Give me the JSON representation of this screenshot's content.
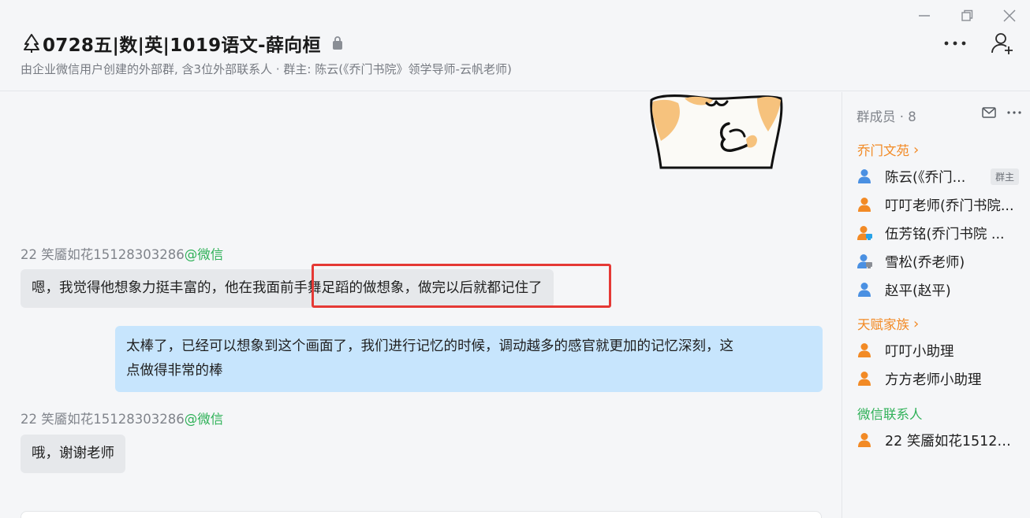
{
  "window": {
    "controls": [
      "minimize",
      "restore",
      "close"
    ]
  },
  "header": {
    "title": "0728五|数|英|1019语文-薛向桓",
    "subtitle": "由企业微信用户创建的外部群, 含3位外部联系人 · 群主: 陈云(《乔门书院》领学导师-云帆老师)"
  },
  "messages": [
    {
      "type": "sticker",
      "direction": "out"
    },
    {
      "type": "text",
      "direction": "in",
      "sender": "22 笑靥如花15128303286",
      "source": "@微信",
      "text": "嗯，我觉得他想象力挺丰富的，他在我面前手舞足蹈的做想象，做完以后就都记住了"
    },
    {
      "type": "text",
      "direction": "out",
      "lines": [
        "太棒了，已经可以想象到这个画面了，我们进行记忆的时候，调动越多的感官就更加的记忆深刻，这",
        "点做得非常的棒"
      ]
    },
    {
      "type": "text",
      "direction": "in",
      "sender": "22 笑靥如花15128303286",
      "source": "@微信",
      "text": "哦，谢谢老师"
    }
  ],
  "sidebar": {
    "title": "群成员 · 8",
    "sections": [
      {
        "label": "乔门文苑",
        "chevron": "›",
        "color": "#f28a25",
        "members": [
          {
            "name": "陈云(《乔门书院》领学导师-云帆老师)",
            "display": "陈云(《乔门...",
            "badge": "群主",
            "avatar": "person-blue"
          },
          {
            "name": "叮叮老师(乔门书院...",
            "avatar": "person-orange"
          },
          {
            "name": "伍芳铭(乔门书院 ...",
            "avatar": "person-orange-pc"
          },
          {
            "name": "雪松(乔老师)",
            "avatar": "person-blue-pc"
          },
          {
            "name": "赵平(赵平)",
            "avatar": "person-blue"
          }
        ]
      },
      {
        "label": "天赋家族",
        "chevron": "›",
        "color": "#f28a25",
        "members": [
          {
            "name": "叮叮小助理",
            "avatar": "person-orange"
          },
          {
            "name": "方方老师小助理",
            "avatar": "person-orange"
          }
        ]
      },
      {
        "label": "微信联系人",
        "color": "#2fb158",
        "members": [
          {
            "name": "22 笑靥如花15128...",
            "avatar": "person-orange"
          }
        ]
      }
    ]
  },
  "colors": {
    "incoming_bubble": "#e6e8eb",
    "outgoing_bubble": "#c7e5fd",
    "wechat_green": "#2fb158",
    "section_orange": "#f28a25",
    "highlight_red": "#e53935"
  }
}
